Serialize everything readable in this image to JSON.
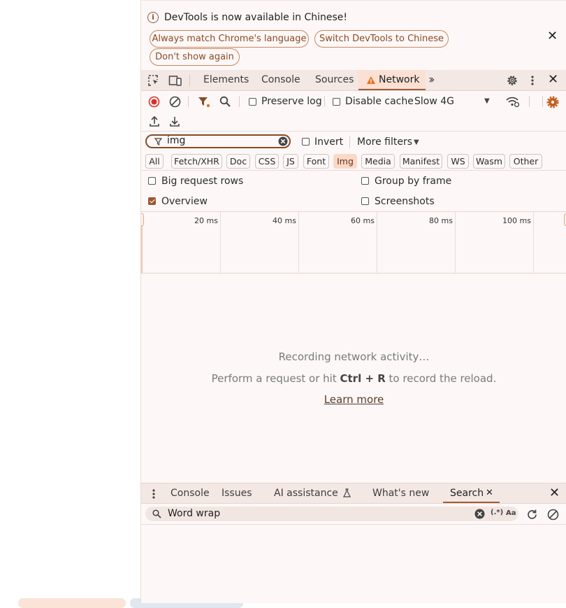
{
  "infobar": {
    "message": "DevTools is now available in Chinese!",
    "btn_match": "Always match Chrome's language",
    "btn_switch": "Switch DevTools to Chinese",
    "btn_dont_show": "Don't show again"
  },
  "tabs": {
    "elements": "Elements",
    "console": "Console",
    "sources": "Sources",
    "network": "Network"
  },
  "toolbar": {
    "preserve_log": "Preserve log",
    "disable_cache": "Disable cache",
    "throttling": "Slow 4G"
  },
  "filter": {
    "value": "img",
    "invert": "Invert",
    "more_filters": "More filters"
  },
  "types": [
    "All",
    "Fetch/XHR",
    "Doc",
    "CSS",
    "JS",
    "Font",
    "Img",
    "Media",
    "Manifest",
    "WS",
    "Wasm",
    "Other"
  ],
  "options": {
    "big_rows": "Big request rows",
    "group_by_frame": "Group by frame",
    "overview": "Overview",
    "screenshots": "Screenshots"
  },
  "timeline": {
    "ticks": [
      "20 ms",
      "40 ms",
      "60 ms",
      "80 ms",
      "100 ms"
    ]
  },
  "empty": {
    "recording": "Recording network activity…",
    "hint_before": "Perform a request or hit ",
    "hint_keys": "Ctrl + R",
    "hint_after": " to record the reload.",
    "learn_more": "Learn more"
  },
  "drawer": {
    "console": "Console",
    "issues": "Issues",
    "ai": "AI assistance",
    "whats_new": "What's new",
    "search": "Search"
  },
  "search": {
    "value": "Word wrap",
    "regex": "(.*)",
    "case": "Aa"
  },
  "colors": {
    "accent": "#a25a34",
    "warning": "#e8711a",
    "record": "#d93025",
    "gear": "#c45e1d"
  }
}
